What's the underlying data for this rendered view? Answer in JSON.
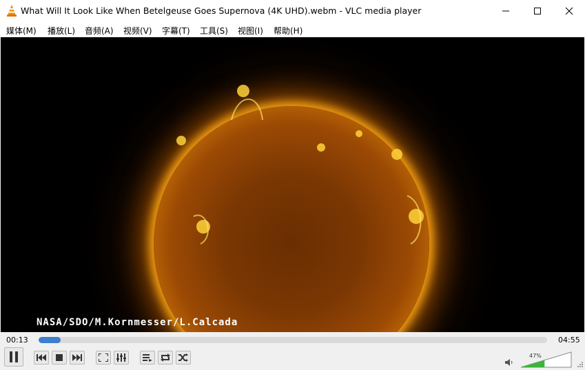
{
  "window": {
    "title": "What Will It Look Like When Betelgeuse Goes Supernova (4K UHD).webm - VLC media player"
  },
  "menu": {
    "items": [
      "媒体(M)",
      "播放(L)",
      "音频(A)",
      "视频(V)",
      "字幕(T)",
      "工具(S)",
      "视图(I)",
      "帮助(H)"
    ]
  },
  "video": {
    "watermark": "NASA/SDO/M.Kornmesser/L.Calcada"
  },
  "playback": {
    "elapsed": "00:13",
    "total": "04:55",
    "progress": 0.044
  },
  "volume": {
    "label": "47%",
    "level": 0.47
  },
  "colors": {
    "accent": "#3c7fd0",
    "volume_fill": "#3cb43c"
  }
}
